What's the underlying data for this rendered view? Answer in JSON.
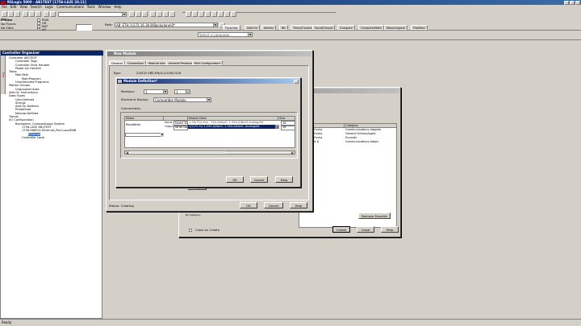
{
  "app": {
    "title": "RSLogix 5000 - AB1TEST [1756-L62E 20.11]"
  },
  "menu": [
    "File",
    "Edit",
    "View",
    "Search",
    "Logic",
    "Communications",
    "Tools",
    "Window",
    "Help"
  ],
  "status_panel": {
    "mode": "Offline",
    "forces": "No Forces",
    "edits": "No Edits",
    "leds": [
      "RUN",
      "OK",
      "BAT",
      "I/O"
    ]
  },
  "toolbar": {
    "path_label": "Path:",
    "path_value": "AB_ETH-1\\172.16.30.8\\Backplane\\0*",
    "language_placeholder": "Select a Language..."
  },
  "instr_tabs": [
    "Favorites",
    "Add-On",
    "Alarms",
    "Bit",
    "Timer/Counter",
    "Input/Output",
    "Compare",
    "Compute/Math",
    "Move/Logical",
    "File/Misc"
  ],
  "organizer": {
    "title": "Controller Organizer",
    "vtab": "Tree",
    "tree": [
      "Controller AB1TEST",
      "Controller Tags",
      "Controller Fault Handler",
      "Power-Up Handler",
      "Tasks",
      "MainTask",
      "MainProgram",
      "Unscheduled Programs",
      "Motion Groups",
      "Ungrouped Axes",
      "Add-On Instructions",
      "Data Types",
      "User-Defined",
      "Strings",
      "Add-On-Defined",
      "Predefined",
      "Module-Defined",
      "Trends",
      "I/O Configuration",
      "Backplane, CompactLogix System",
      "1756-L62E AB1TEST",
      "1756-ENBT/A Ethernet_Port LocalENB",
      "Ethernet",
      "Controller Local"
    ],
    "selected": "Ethernet"
  },
  "back_dialog": {
    "grid_headers": [
      "Vendor",
      "Category"
    ],
    "rows": [
      [
        "Prosoft + Fusha",
        "Communications Adapter"
      ],
      [
        "Prosoft + Fusha",
        "General Drives/Applic"
      ],
      [
        "Prosoft + Fusha",
        "Encoder"
      ],
      [
        "Dextechnic A",
        "Communications Adapt"
      ]
    ],
    "buttons": {
      "remove_favorite": "Remove Favorite",
      "create": "Create",
      "close": "Close",
      "help": "Help"
    },
    "close_on_create": "Close on Create",
    "show_label": "By Category"
  },
  "new_module": {
    "title": "New Module",
    "tabs": [
      "General",
      "Connection",
      "Module Info",
      "Internet Protocol",
      "Port Configuration"
    ],
    "type_label": "Type:",
    "type_value": "22SCD VBS-EN/X-2/1000-516",
    "change_button": "Change...",
    "status": "Status: Creating",
    "buttons": {
      "ok": "OK",
      "cancel": "Cancel",
      "help": "Help"
    }
  },
  "module_def": {
    "title": "Module Definition*",
    "revision_label": "Revision:",
    "revision_major": "1",
    "revision_minor": "1",
    "keying_label": "Electronic Keying:",
    "keying_value": "Compatible Module",
    "connections_label": "Connections:",
    "grid_headers": [
      "Name",
      "",
      "Names Data",
      "Size"
    ],
    "conn_name": "ReadWrite",
    "input_label": "Input:",
    "output_label": "Output:",
    "input_type": "Name Data",
    "output_type": "Write Data",
    "input_data": "1-3X/754 mm - 3X4-A/Nor0, 1-3X4-A/Nor0 Analog/Alt",
    "output_data": "1/2(75 in) 1-2X4-A/Nor0, 1-3X4-A/Nor0, Analog/Alt",
    "input_size": "16",
    "output_size": "16",
    "buttons": {
      "ok": "OK",
      "cancel": "Cancel",
      "help": "Help"
    }
  },
  "statusbar": {
    "text": "Ready"
  },
  "colors": {
    "accent": "#0a246a",
    "highlight": "#316ac5",
    "face": "#d4d0c8"
  }
}
